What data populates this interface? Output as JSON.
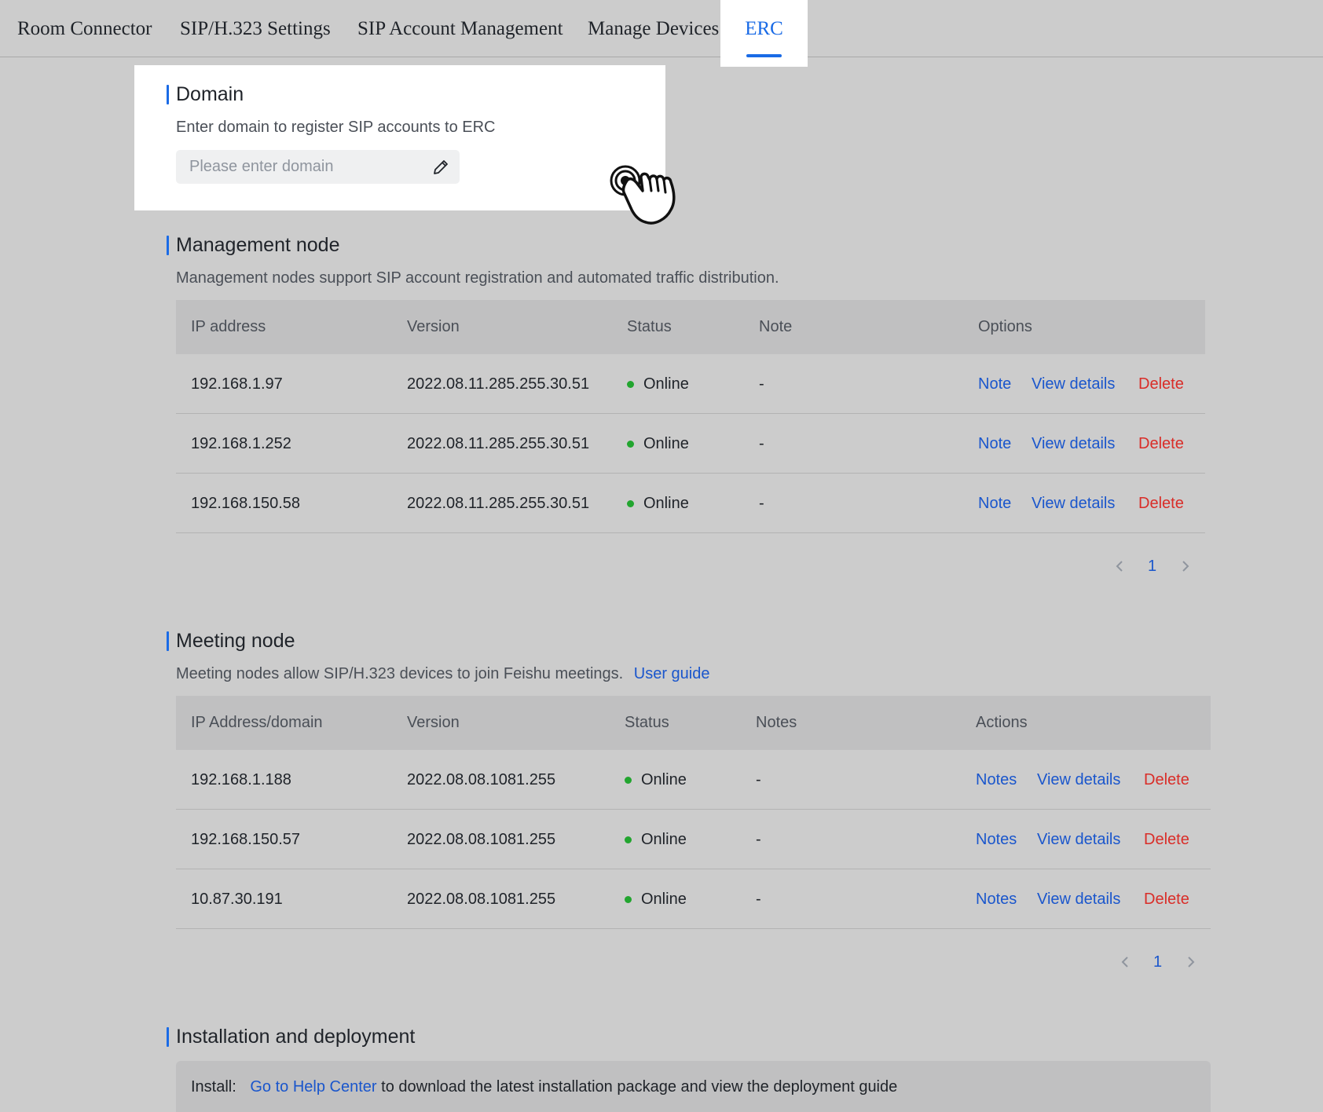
{
  "tabs": {
    "room_connector": "Room Connector",
    "sip_h323_settings": "SIP/H.323 Settings",
    "sip_account_management": "SIP Account Management",
    "manage_devices": "Manage Devices",
    "erc": "ERC",
    "active": "ERC"
  },
  "domain": {
    "title": "Domain",
    "description": "Enter domain to register SIP accounts to ERC",
    "placeholder": "Please enter domain",
    "value": ""
  },
  "management_node": {
    "title": "Management node",
    "description": "Management nodes support SIP account registration and automated traffic distribution.",
    "columns": [
      "IP address",
      "Version",
      "Status",
      "Note",
      "Options"
    ],
    "rows": [
      {
        "ip": "192.168.1.97",
        "version": "2022.08.11.285.255.30.51",
        "status": "Online",
        "note": "-"
      },
      {
        "ip": "192.168.1.252",
        "version": "2022.08.11.285.255.30.51",
        "status": "Online",
        "note": "-"
      },
      {
        "ip": "192.168.150.58",
        "version": "2022.08.11.285.255.30.51",
        "status": "Online",
        "note": "-"
      }
    ],
    "actions": {
      "note": "Note",
      "view": "View details",
      "delete": "Delete"
    },
    "page": "1"
  },
  "meeting_node": {
    "title": "Meeting node",
    "description": "Meeting nodes allow SIP/H.323 devices to join Feishu meetings.",
    "guide_link": "User guide",
    "columns": [
      "IP Address/domain",
      "Version",
      "Status",
      "Notes",
      "Actions"
    ],
    "rows": [
      {
        "ip": "192.168.1.188",
        "version": "2022.08.08.1081.255",
        "status": "Online",
        "note": "-"
      },
      {
        "ip": "192.168.150.57",
        "version": "2022.08.08.1081.255",
        "status": "Online",
        "note": "-"
      },
      {
        "ip": "10.87.30.191",
        "version": "2022.08.08.1081.255",
        "status": "Online",
        "note": "-"
      }
    ],
    "actions": {
      "note": "Notes",
      "view": "View details",
      "delete": "Delete"
    },
    "page": "1"
  },
  "installation": {
    "title": "Installation and deployment",
    "install_label": "Install:",
    "help_link": "Go to Help Center",
    "install_text": "to download the latest installation package and view the deployment guide"
  },
  "colors": {
    "accent": "#1a6be6",
    "link": "#1a56cc",
    "danger": "#d92d28",
    "online": "#22a52f",
    "background": "#cccccc"
  }
}
